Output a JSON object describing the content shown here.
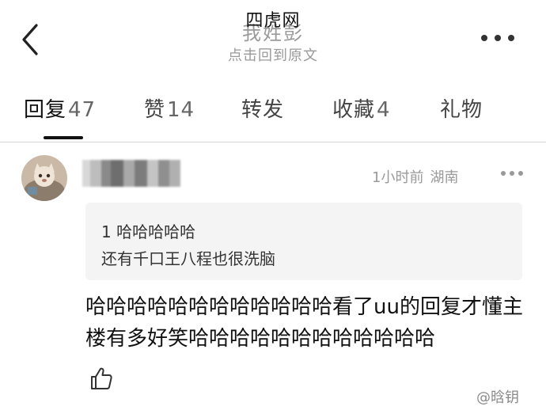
{
  "header": {
    "watermark_title": "四虎网",
    "title": "我姓彭",
    "subtitle": "点击回到原文"
  },
  "tabs": [
    {
      "label": "回复",
      "count": "47",
      "active": true
    },
    {
      "label": "赞",
      "count": "14",
      "active": false
    },
    {
      "label": "转发",
      "count": "",
      "active": false
    },
    {
      "label": "收藏",
      "count": "4",
      "active": false
    },
    {
      "label": "礼物",
      "count": "",
      "active": false
    }
  ],
  "comment": {
    "time": "1小时前",
    "location": "湖南",
    "quote": {
      "line1": "1 哈哈哈哈哈",
      "line2": "还有千口王八程也很洗脑"
    },
    "body": "哈哈哈哈哈哈哈哈哈哈哈哈看了uu的回复才懂主楼有多好笑哈哈哈哈哈哈哈哈哈哈哈哈"
  },
  "watermark": "@晗钥",
  "colors": {
    "accent": "#111111",
    "muted": "#9a9a9a",
    "quote_bg": "#f4f4f4"
  },
  "icons": {
    "back": "chevron-left-icon",
    "more": "more-horizontal-icon",
    "options": "more-horizontal-icon",
    "like": "thumbs-up-icon"
  }
}
